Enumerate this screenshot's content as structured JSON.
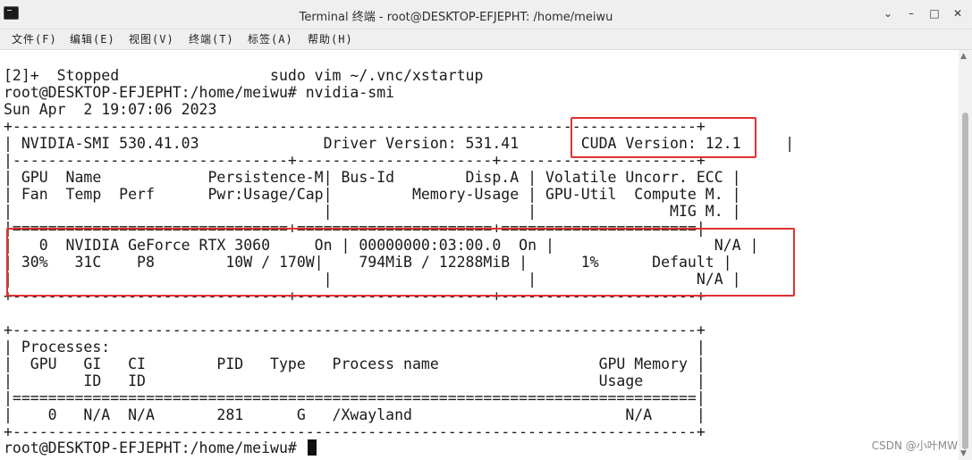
{
  "window": {
    "title": "Terminal 终端 - root@DESKTOP-EFJEPHT: /home/meiwu",
    "controls": [
      "⌄",
      "–",
      "□",
      "✕"
    ]
  },
  "menubar": {
    "items": [
      "文件(F)",
      "编辑(E)",
      "视图(V)",
      "终端(T)",
      "标签(A)",
      "帮助(H)"
    ]
  },
  "terminal": {
    "lines": [
      "[2]+  Stopped                 sudo vim ~/.vnc/xstartup",
      "root@DESKTOP-EFJEPHT:/home/meiwu# nvidia-smi",
      "Sun Apr  2 19:07:06 2023",
      "+-----------------------------------------------------------------------------+",
      "| NVIDIA-SMI 530.41.03              Driver Version: 531.41       CUDA Version: 12.1     |",
      "|-------------------------------+----------------------+----------------------+",
      "| GPU  Name            Persistence-M| Bus-Id        Disp.A | Volatile Uncorr. ECC |",
      "| Fan  Temp  Perf      Pwr:Usage/Cap|         Memory-Usage | GPU-Util  Compute M. |",
      "|                                   |                      |               MIG M. |",
      "|===============================+======================+======================|",
      "|   0  NVIDIA GeForce RTX 3060     On | 00000000:03:00.0  On |                  N/A |",
      "| 30%   31C    P8        10W / 170W|    794MiB / 12288MiB |      1%      Default |",
      "|                                   |                      |                  N/A |",
      "+-------------------------------+----------------------+----------------------+",
      "",
      "+-----------------------------------------------------------------------------+",
      "| Processes:                                                                  |",
      "|  GPU   GI   CI        PID   Type   Process name                  GPU Memory |",
      "|        ID   ID                                                   Usage      |",
      "|=============================================================================|",
      "|    0   N/A  N/A       281      G   /Xwayland                        N/A     |",
      "+-----------------------------------------------------------------------------+",
      "root@DESKTOP-EFJEPHT:/home/meiwu# "
    ]
  },
  "watermark": "CSDN @小叶MW",
  "colors": {
    "highlight": "#e03131",
    "terminal_bg": "#ffffff",
    "terminal_fg": "#1a1a1a"
  }
}
